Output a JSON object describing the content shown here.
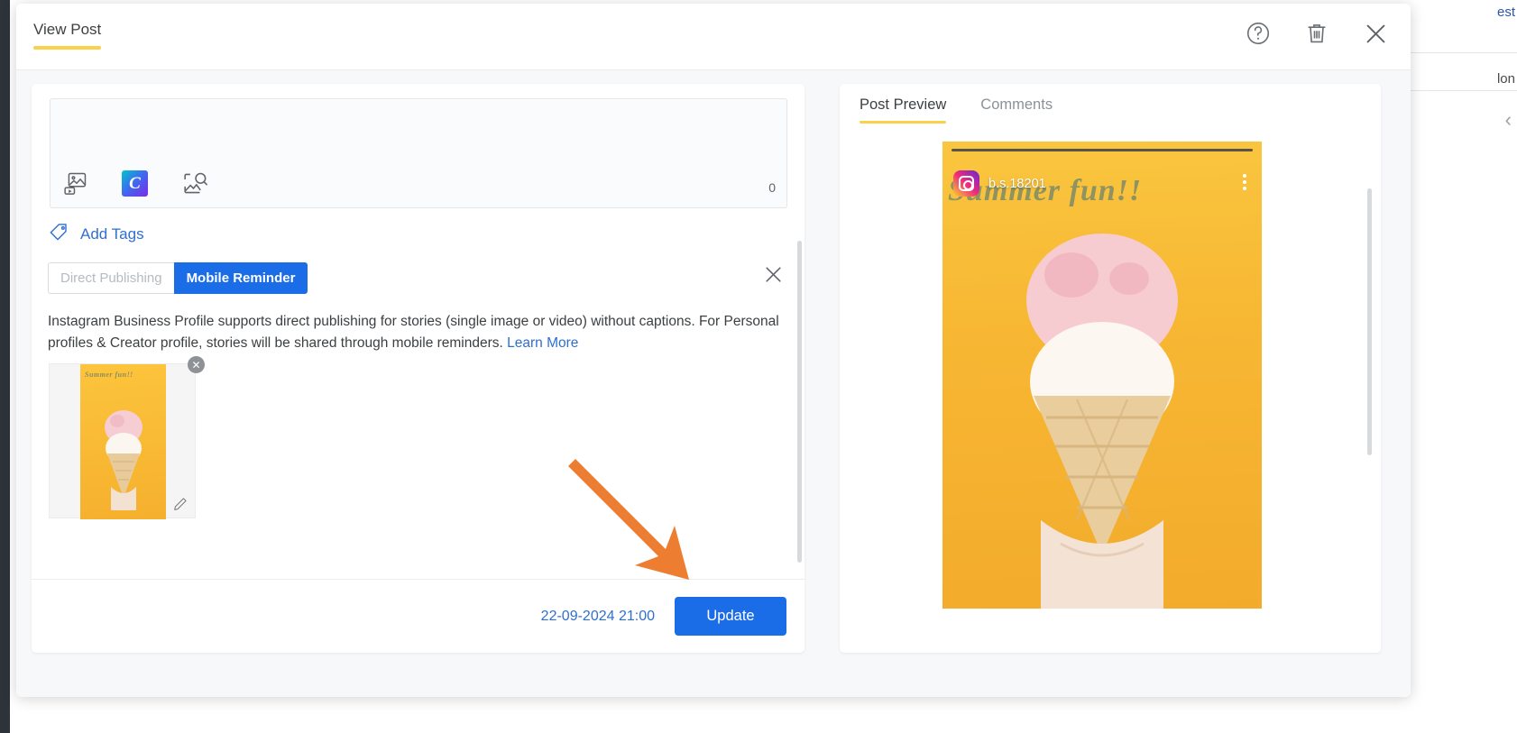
{
  "background": {
    "text_right_top": "est",
    "text_right_mid": "lon",
    "chevron_icon": "chevron-left-icon"
  },
  "header": {
    "tab_label": "View Post",
    "help_icon": "help-circle-icon",
    "delete_icon": "trash-icon",
    "close_icon": "close-icon"
  },
  "composer": {
    "media": {
      "upload_icon": "media-upload-icon",
      "canva_icon": "canva-icon",
      "canva_letter": "C",
      "image_search_icon": "image-search-icon",
      "counter": "0"
    },
    "add_tags": {
      "label": "Add Tags",
      "icon": "tag-icon"
    },
    "publish_mode": {
      "option_direct": "Direct Publishing",
      "option_reminder": "Mobile Reminder",
      "selected": "Mobile Reminder",
      "dismiss_icon": "close-icon"
    },
    "info": {
      "text": "Instagram Business Profile supports direct publishing for stories (single image or video) without captions. For Personal profiles & Creator profile, stories will be shared through mobile reminders. ",
      "link_label": "Learn More"
    },
    "attachment": {
      "caption": "Summer  fun!!",
      "remove_icon": "remove-circle-icon",
      "edit_icon": "pencil-icon"
    },
    "footer": {
      "schedule_datetime": "22-09-2024 21:00",
      "update_label": "Update"
    }
  },
  "preview": {
    "tabs": [
      {
        "label": "Post Preview",
        "active": true
      },
      {
        "label": "Comments",
        "active": false
      }
    ],
    "story": {
      "username": "b.s.18201",
      "avatar_icon": "instagram-logo-icon",
      "menu_icon": "more-vertical-icon",
      "caption": "Summer  fun!!"
    }
  },
  "colors": {
    "accent_blue": "#1a6ce7",
    "tab_underline": "#f9d14a",
    "link_blue": "#2f6fd0",
    "arrow_orange": "#ed7d31"
  }
}
